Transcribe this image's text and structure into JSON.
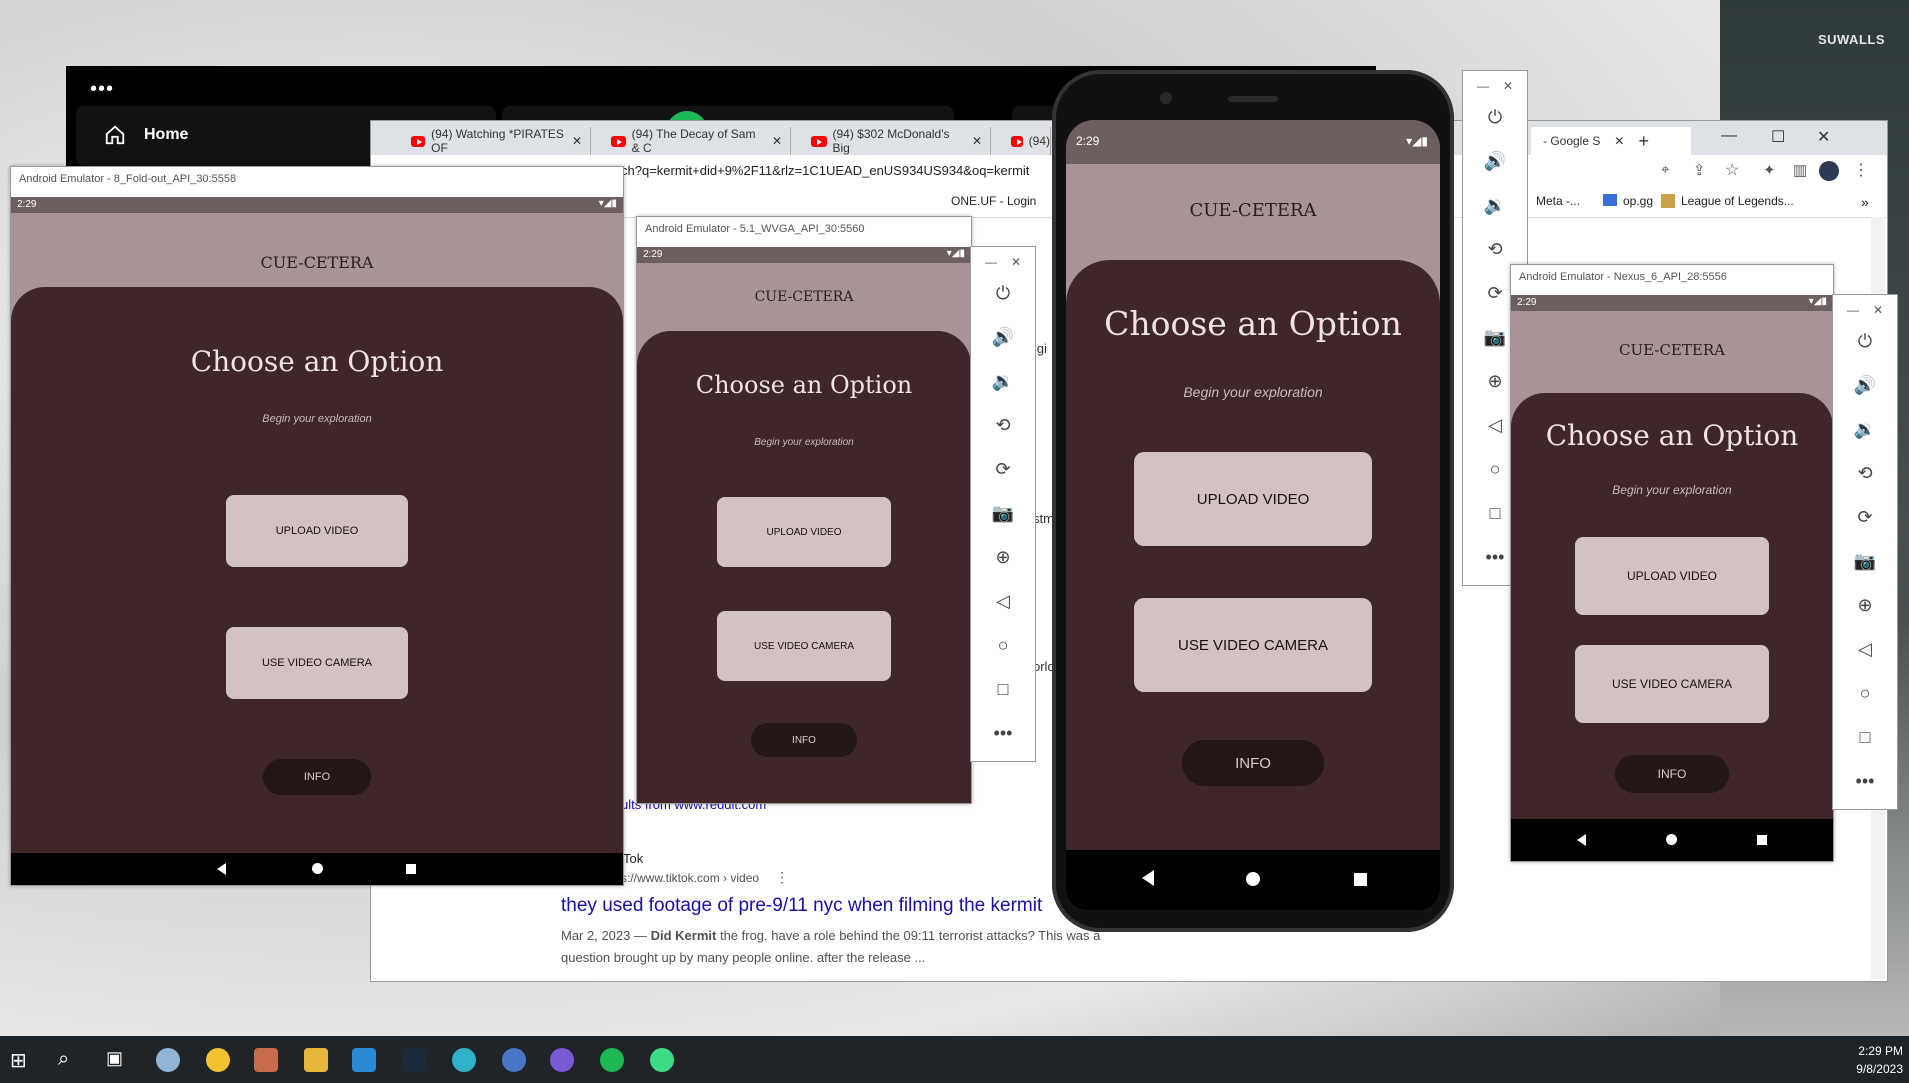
{
  "wallpaper": {
    "brand": "SUWALLS"
  },
  "spotify": {
    "home_label": "Home",
    "menu": "•••"
  },
  "browser": {
    "tabs": [
      {
        "label": "(94) Watching *PIRATES OF"
      },
      {
        "label": "(94) The Decay of Sam & C"
      },
      {
        "label": "(94) $302 McDonald's Big"
      },
      {
        "label": "(94)"
      }
    ],
    "google_tab": "- Google S",
    "url": "ch?q=kermit+did+9%2F11&rlz=1C1UEAD_enUS934US934&oq=kermit",
    "bookmarks": [
      "ONE.UF - Login",
      "Meta -...",
      "op.gg",
      "League of Legends..."
    ],
    "results": {
      "reddit_link": "ults from www.reddit.com",
      "tiktok_source": "Tok",
      "tiktok_url": "s://www.tiktok.com › video",
      "title": "they used footage of pre-9/11 nyc when filming the kermit",
      "snippet_date": "Mar 2, 2023",
      "snippet_bold": "Did Kermit",
      "snippet_rest": " the frog. have a role behind the 09:11 terrorist attacks? This was a",
      "snippet_line2": "question brought up by many people online. after the release ...",
      "frag_1": "ligi",
      "frag_2": "stma",
      "frag_3": "orld"
    }
  },
  "app": {
    "title": "CUE-CETERA",
    "heading": "Choose an Option",
    "subheading": "Begin your exploration",
    "upload_label": "UPLOAD VIDEO",
    "camera_label": "USE VIDEO CAMERA",
    "info_label": "INFO",
    "time": "2:29"
  },
  "emulators": {
    "fold": {
      "title": "Android Emulator - 8_Fold-out_API_30:5558"
    },
    "wvga": {
      "title": "Android Emulator - 5.1_WVGA_API_30:5560"
    },
    "nexus": {
      "title": "Android Emulator - Nexus_6_API_28:5556"
    }
  },
  "taskbar": {
    "time": "2:29 PM",
    "date": "9/8/2023"
  },
  "colors": {
    "app_header": "#a89494",
    "app_card": "#3f2729",
    "button": "#d3c2c2",
    "pill": "#231616"
  }
}
